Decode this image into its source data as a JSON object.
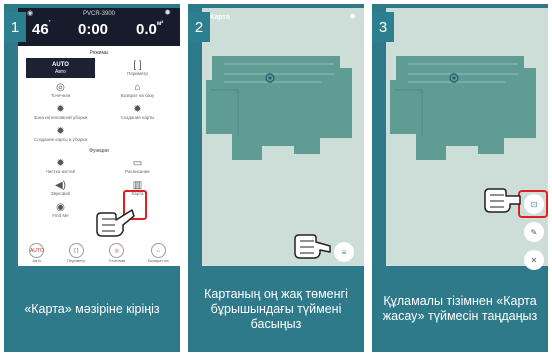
{
  "panel1": {
    "step": "1",
    "app": {
      "model": "PVCR-3900",
      "stat_left": "46",
      "stat_left_unit": "˚",
      "stat_center": "0:00",
      "stat_right": "0.0",
      "stat_right_unit": "м²",
      "section_modes": "Режимы",
      "tiles_modes": [
        {
          "icon": "AUTO",
          "label": "Авто",
          "selected": true
        },
        {
          "icon": "[ ]",
          "label": "Периметр"
        },
        {
          "icon": "◎",
          "label": "Точечная"
        },
        {
          "icon": "⌂",
          "label": "Возврат на базу"
        },
        {
          "icon": "✹",
          "label": "Зона интенсивной уборки"
        },
        {
          "icon": "✹",
          "label": "Создание карты"
        },
        {
          "icon": "✹",
          "label": "Создание карты и уборка"
        }
      ],
      "section_functions": "Функции",
      "tiles_functions": [
        {
          "icon": "✹",
          "label": "Чистка кистей"
        },
        {
          "icon": "▭",
          "label": "Расписание"
        },
        {
          "icon": "◀)",
          "label": "Звуковой"
        },
        {
          "icon": "▥",
          "label": "Карта"
        },
        {
          "icon": "◉",
          "label": "Find Me"
        }
      ],
      "bottom_nav": [
        {
          "icon": "AUTO",
          "label": "Авто"
        },
        {
          "icon": "[ ]",
          "label": "Периметр"
        },
        {
          "icon": "◎",
          "label": "Точечная"
        },
        {
          "icon": "⌂",
          "label": "Возврат на"
        }
      ]
    },
    "caption": "«Карта» мәзіріне кіріңіз"
  },
  "panel2": {
    "step": "2",
    "screen_title": "Карта",
    "button_icon": "≡",
    "caption": "Картаның оң жақ төменгі бұрышындағы түймені басыңыз"
  },
  "panel3": {
    "step": "3",
    "buttons": [
      "⊡",
      "✎",
      "✕"
    ],
    "caption": "Құламалы тізімнен «Карта жасау» түймесін таңдаңыз"
  },
  "colors": {
    "panel_bg": "#2f7a8a",
    "app_header": "#161c2c",
    "map_bg": "#cdddd8",
    "map_floor": "#5f9c94",
    "highlight": "#e02020"
  }
}
